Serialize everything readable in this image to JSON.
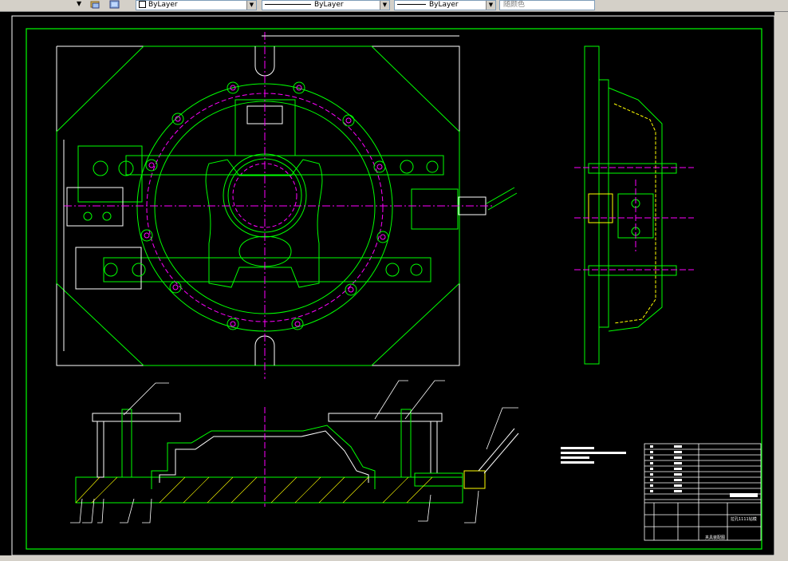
{
  "toolbar": {
    "layer_linetype": "ByLayer",
    "linetype": "ByLayer",
    "lineweight": "ByLayer",
    "plotstyle": "随颜色"
  },
  "title_block": {
    "drawing_title": "拉孔1111钻模",
    "footer_label": "夹具装配图"
  },
  "colors": {
    "background": "#000000",
    "green": "#00ff00",
    "magenta": "#ff00ff",
    "yellow": "#ffff00",
    "white": "#ffffff",
    "red": "#ff0000",
    "border": "#00ff00"
  }
}
